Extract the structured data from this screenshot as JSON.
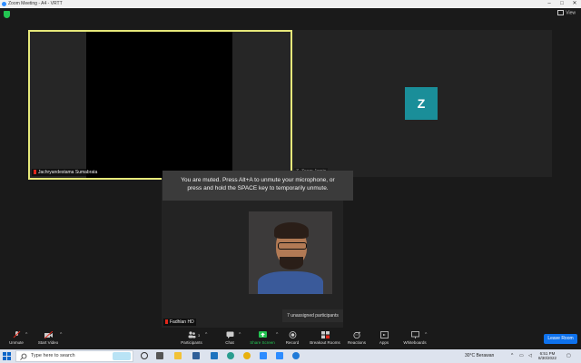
{
  "window": {
    "title": "Zoom Meeting - A4 - VRTT",
    "view_label": "View"
  },
  "participants_grid": {
    "tile1_name": "Jachryandestama Sumabrata",
    "tile2_avatar": "Z",
    "tile2_name": "Z. Zoom Jamin",
    "tile3_name": "Fadhlan HD"
  },
  "notice": {
    "line1": "You are muted. Press Alt+A to unmute your microphone, or",
    "line2": "press and hold the SPACE key to temporarily unmute."
  },
  "unassigned_label": "7 unassigned participants",
  "toolbar": {
    "unmute": "Unmute",
    "start_video": "Start Video",
    "participants": "Participants",
    "participants_count": "3",
    "chat": "Chat",
    "share_screen": "Share Screen",
    "record": "Record",
    "breakout_rooms": "Breakout Rooms",
    "reactions": "Reactions",
    "apps": "Apps",
    "whiteboards": "Whiteboards",
    "leave": "Leave Room"
  },
  "taskbar": {
    "search_placeholder": "Type here to search",
    "weather": "30°C  Berawan",
    "time": "6:51 PM",
    "date": "8/30/2022"
  },
  "colors": {
    "active_speaker_border": "#e6e87a",
    "avatar_bg": "#1a8e99",
    "leave_button": "#0e72ed",
    "share_screen": "#23c552",
    "muted_mic": "#e0271a"
  }
}
